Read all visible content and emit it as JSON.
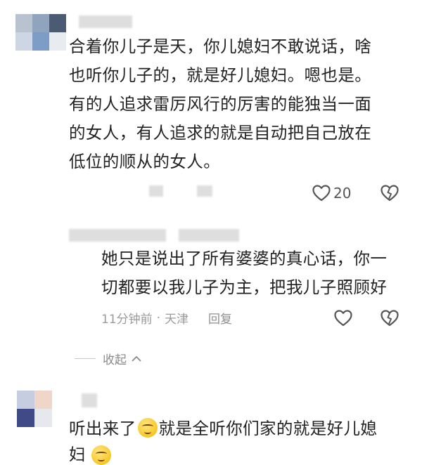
{
  "comment_1": {
    "lines": [
      "合着你儿子是天，你儿媳妇不敢说话，啥",
      "也听你儿子的，就是好儿媳妇。嗯也是。",
      "有的人追求雷厉风行的厉害的能独当一面",
      "的女人，有人追求的就是自动把自己放在",
      "低位的顺从的女人。"
    ],
    "like_count": "20"
  },
  "reply": {
    "lines": [
      "她只是说出了所有婆婆的真心话，你一",
      "切都要以我儿子为主，把我儿子照顾好"
    ],
    "time": "11分钟前",
    "separator": "·",
    "location": "天津",
    "reply_label": "回复"
  },
  "collapse": {
    "label": "收起"
  },
  "comment_2": {
    "text_before_emoji": "听出来了",
    "text_after_emoji": "就是全听你们家的就是好儿媳",
    "next_line_partial": "妇"
  },
  "icons": {
    "like": "heart-outline-icon",
    "dislike": "broken-heart-icon",
    "collapse": "chevron-up-icon",
    "emoji": "smirk-emoji-icon"
  },
  "colors": {
    "text": "#222222",
    "meta": "#9a9a9a",
    "icon": "#555555"
  }
}
